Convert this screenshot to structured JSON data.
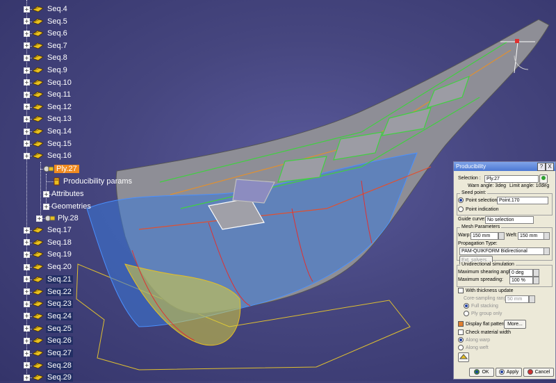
{
  "tree": {
    "sequences_top": [
      "Seq.4",
      "Seq.5",
      "Seq.6",
      "Seq.7",
      "Seq.8",
      "Seq.9",
      "Seq.10",
      "Seq.11",
      "Seq.12",
      "Seq.13",
      "Seq.14",
      "Seq.15",
      "Seq.16"
    ],
    "ply_selected": "Ply.27",
    "ply_children": [
      "Producibility params",
      "Attributes",
      "Geometries"
    ],
    "ply_next": "Ply.28",
    "sequences_bottom": [
      "Seq.17",
      "Seq.18",
      "Seq.19",
      "Seq.20",
      "Seq.21",
      "Seq.22",
      "Seq.23",
      "Seq.24",
      "Seq.25",
      "Seq.26",
      "Seq.27",
      "Seq.28",
      "Seq.29"
    ],
    "highlighted": [
      "Seq.21",
      "Seq.22",
      "Seq.23",
      "Seq.24",
      "Seq.25",
      "Seq.26",
      "Seq.27",
      "Seq.28",
      "Seq.29"
    ]
  },
  "dialog": {
    "title": "Producibility",
    "help": "?",
    "close": "X",
    "selection_label": "Selection :",
    "selection_value": "Ply.27",
    "warn_angle": "Warn angle: 3deg",
    "limit_angle": "Limit angle: 10deg",
    "seed_point_label": "Seed point:",
    "point_selection_label": "Point selection",
    "point_selection_value": "Point.170",
    "point_indication_label": "Point indication",
    "guide_curve_label": "Guide curve:",
    "guide_curve_value": "No selection",
    "mesh_params_label": "Mesh Parameters",
    "warp_label": "Warp:",
    "warp_value": "150 mm",
    "weft_label": "Weft:",
    "weft_value": "150 mm",
    "propagation_type_label": "Propagation Type:",
    "propagation_type_value": "PAM-QUIKFORM Bidirectional",
    "ext_solvers_label": "Ext. solvers...",
    "unidirectional_label": "Unidirectional simulation",
    "max_shearing_label": "Maximum shearing angle:",
    "max_shearing_value": "0 deg",
    "max_spreading_label": "Maximum spreading:",
    "max_spreading_value": "100 %",
    "thickness_update_label": "With thickness update",
    "core_sampling_label": "Core-sampling range:",
    "core_sampling_value": "50 mm",
    "full_stacking_label": "Full stacking",
    "ply_group_only_label": "Ply group only",
    "display_flat_label": "Display flat pattern",
    "more_label": "More...",
    "check_material_label": "Check material width",
    "along_warp_label": "Along warp",
    "along_weft_label": "Along weft",
    "ok_label": "OK",
    "apply_label": "Apply",
    "cancel_label": "Cancel"
  },
  "colors": {
    "background": "#46467f",
    "selection_highlight": "#f08a20",
    "tree_highlight": "#232f64",
    "dialog_bg": "#ece9d8",
    "title_bar": "#4d78d4"
  }
}
